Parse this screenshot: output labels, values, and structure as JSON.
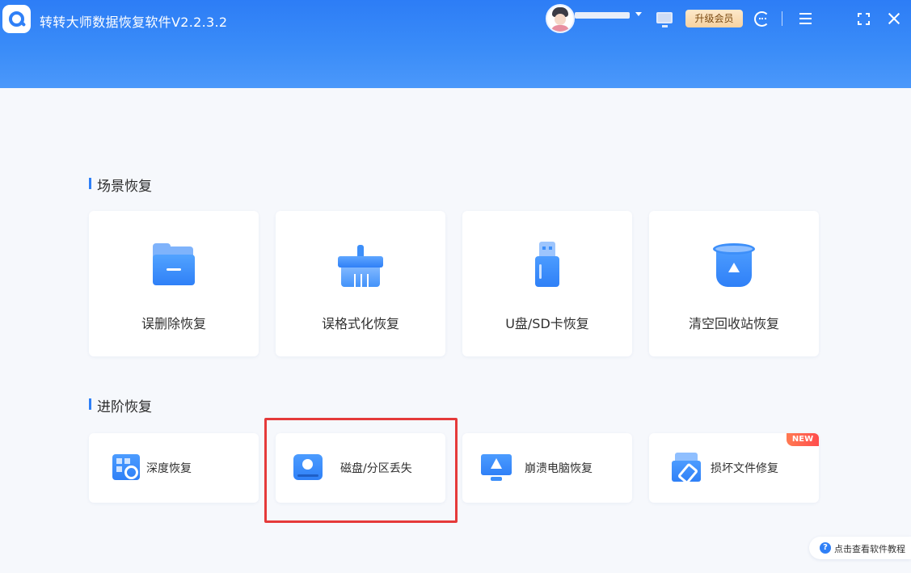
{
  "app": {
    "title": "转转大师数据恢复软件V2.2.3.2"
  },
  "header": {
    "vip_label": "升级会员"
  },
  "scenario": {
    "title": "场景恢复",
    "cards": [
      {
        "label": "误删除恢复",
        "icon": "folder-icon"
      },
      {
        "label": "误格式化恢复",
        "icon": "broom-icon"
      },
      {
        "label": "U盘/SD卡恢复",
        "icon": "usb-drive-icon"
      },
      {
        "label": "清空回收站恢复",
        "icon": "recycle-bin-icon"
      }
    ]
  },
  "advanced": {
    "title": "进阶恢复",
    "cards": [
      {
        "label": "深度恢复",
        "icon": "deep-scan-icon"
      },
      {
        "label": "磁盘/分区丢失",
        "icon": "disk-icon"
      },
      {
        "label": "崩溃电脑恢复",
        "icon": "crashed-pc-icon"
      },
      {
        "label": "损坏文件修复",
        "icon": "file-repair-icon",
        "badge": "NEW"
      }
    ]
  },
  "help": {
    "label": "点击查看软件教程",
    "icon_glyph": "?"
  },
  "colors": {
    "accent": "#2f80f7",
    "highlight": "#e53a3a",
    "badge": "#ff4d4d"
  }
}
